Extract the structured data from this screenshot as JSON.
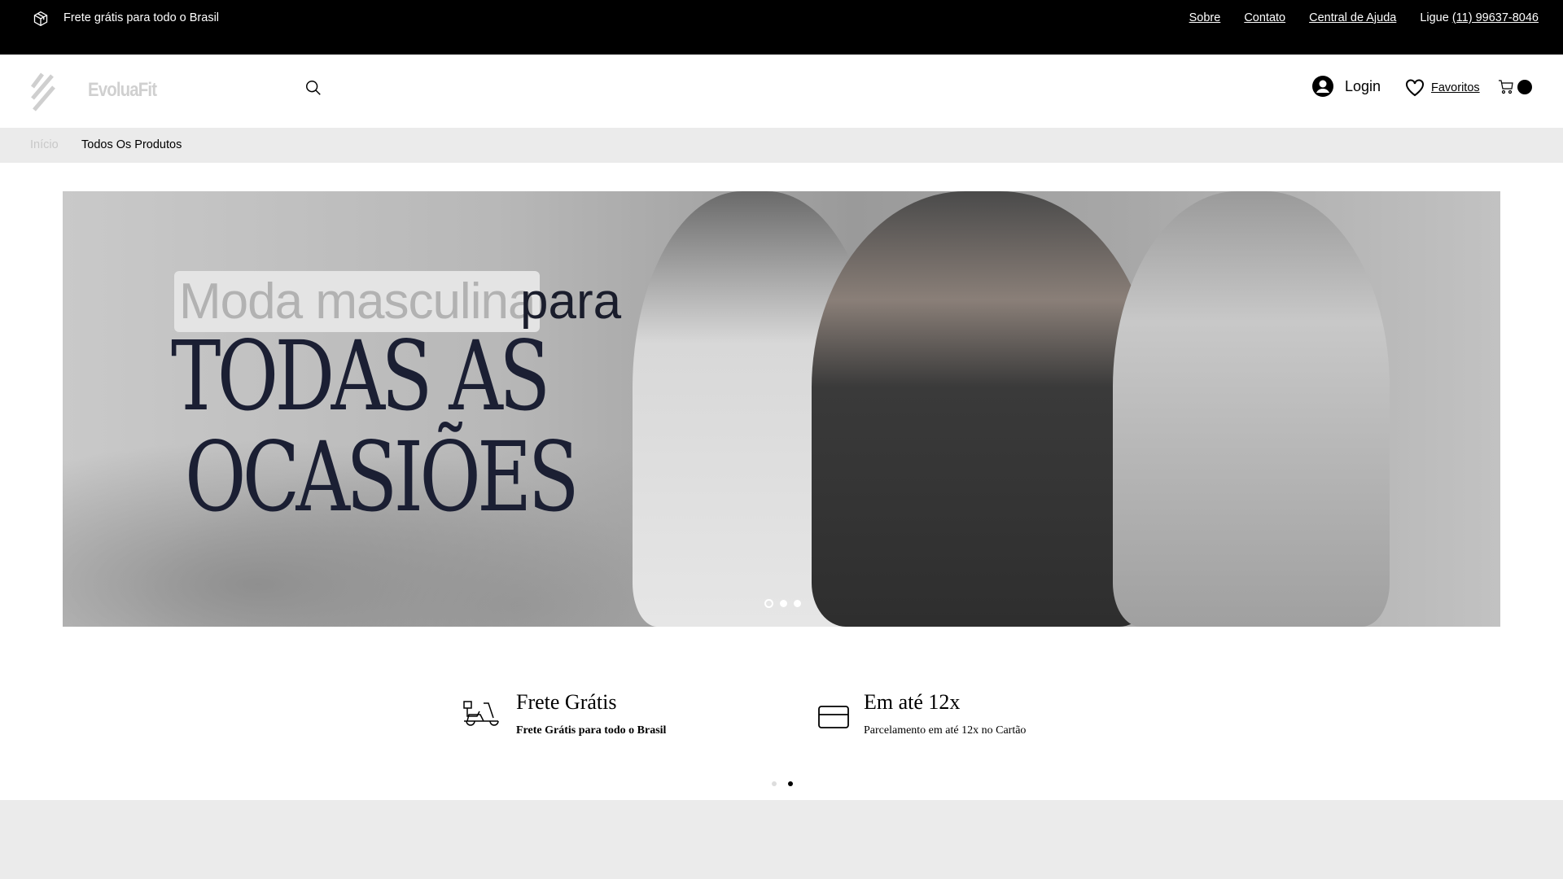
{
  "topbar": {
    "shipping": "Frete grátis para todo o Brasil",
    "links": [
      "Sobre",
      "Contato",
      "Central de Ajuda"
    ],
    "phone_prefix": "Ligue ",
    "phone": "(11) 99637-8046"
  },
  "header": {
    "brand": "EvoluaFit",
    "login": "Login",
    "favorites": "Favoritos"
  },
  "breadcrumb": [
    "Início",
    "Todos Os Produtos"
  ],
  "banner": {
    "tag": "Moda masculina",
    "para": "para",
    "line1": "TODAS AS",
    "line2": "OCASIÕES",
    "slides": 3,
    "active_slide": 1
  },
  "features": [
    {
      "title": "Frete Grátis",
      "subtitle": "Frete Grátis para todo o Brasil",
      "icon": "delivery-scooter-icon"
    },
    {
      "title": "Em até 12x",
      "subtitle": "Parcelamento em até 12x no Cartão",
      "icon": "credit-card-icon"
    }
  ],
  "features_pages": 2,
  "features_active_page": 2
}
